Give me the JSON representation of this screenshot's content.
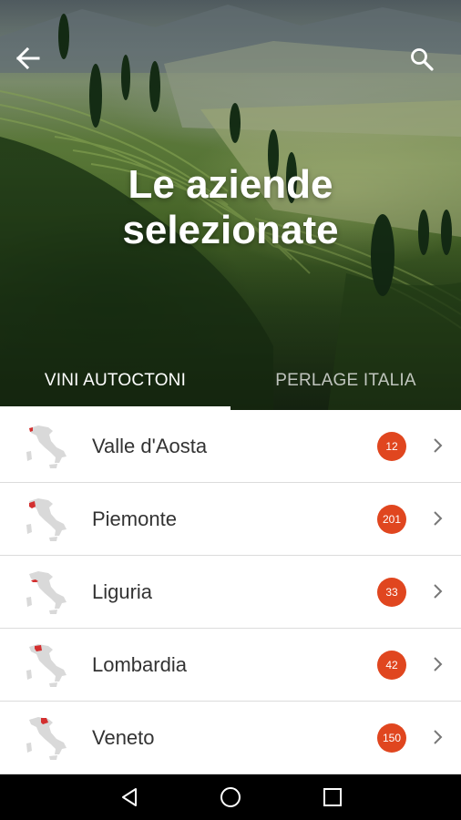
{
  "header": {
    "title_line1": "Le aziende",
    "title_line2": "selezionate",
    "back_icon": "arrow-left-icon",
    "search_icon": "search-icon"
  },
  "tabs": [
    {
      "label": "VINI AUTOCTONI",
      "active": true
    },
    {
      "label": "PERLAGE ITALIA",
      "active": false
    }
  ],
  "regions": [
    {
      "name": "Valle d'Aosta",
      "count": "12",
      "icon": "italy-map-icon"
    },
    {
      "name": "Piemonte",
      "count": "201",
      "icon": "italy-map-icon"
    },
    {
      "name": "Liguria",
      "count": "33",
      "icon": "italy-map-icon"
    },
    {
      "name": "Lombardia",
      "count": "42",
      "icon": "italy-map-icon"
    },
    {
      "name": "Veneto",
      "count": "150",
      "icon": "italy-map-icon"
    }
  ],
  "navbar": [
    "back-triangle-icon",
    "home-circle-icon",
    "recents-square-icon"
  ],
  "colors": {
    "accent": "#e0461f",
    "highlight_region": "#d32f2f",
    "map_gray": "#d9d9d9"
  }
}
